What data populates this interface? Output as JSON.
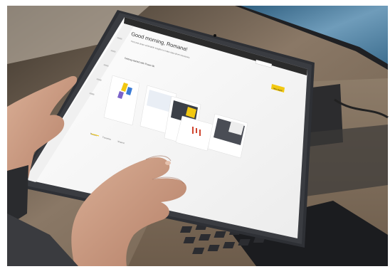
{
  "scene": {
    "subject": "hands-using-tablet-with-power-bi-home",
    "colors": {
      "desk": "#7d6e5c",
      "tablet_bezel": "#2e3035",
      "screen": "#f7f7f7",
      "accent_yellow": "#f2c811",
      "monitor_blue": "#4d7fa6",
      "skin": "#c99a80"
    }
  },
  "tablet_screen": {
    "greeting": "Good morning, Romana!",
    "subtitle": "Find and share actionable insights to make data-driven decisions",
    "section_heading": "Getting started with Power BI",
    "tabs": [
      "Recent",
      "Favorites",
      "Shared"
    ],
    "primary_button": "New report"
  }
}
